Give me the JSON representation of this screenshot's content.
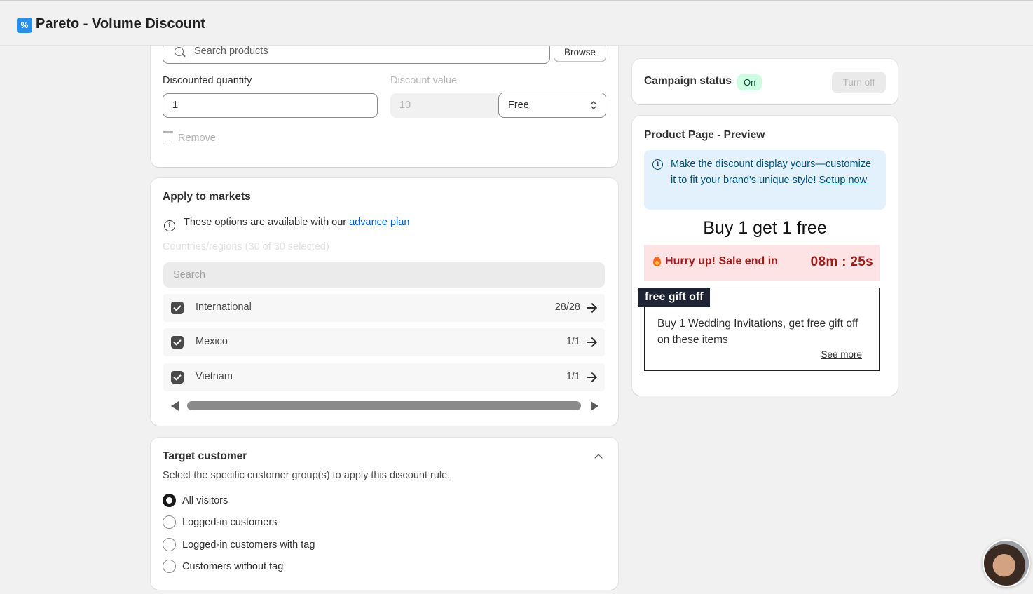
{
  "app": {
    "logo_glyph": "%",
    "title": "Pareto - Volume Discount"
  },
  "product_rule": {
    "search_placeholder": "Search products",
    "browse_label": "Browse",
    "discounted_quantity_label": "Discounted quantity",
    "discounted_quantity_value": "1",
    "discount_value_label": "Discount value",
    "discount_value": "10",
    "discount_type_selected": "Free",
    "remove_label": "Remove"
  },
  "markets": {
    "title": "Apply to markets",
    "info_prefix": "These options are available with our",
    "info_link": "advance plan",
    "countries_label": "Countries/regions (30 of 30 selected)",
    "search_placeholder": "Search",
    "items": [
      {
        "name": "International",
        "count": "28/28",
        "checked": true
      },
      {
        "name": "Mexico",
        "count": "1/1",
        "checked": true
      },
      {
        "name": "Vietnam",
        "count": "1/1",
        "checked": true
      }
    ]
  },
  "target_customer": {
    "title": "Target customer",
    "description": "Select the specific customer group(s) to apply this discount rule.",
    "options": [
      {
        "label": "All visitors",
        "selected": true
      },
      {
        "label": "Logged-in customers",
        "selected": false
      },
      {
        "label": "Logged-in customers with tag",
        "selected": false
      },
      {
        "label": "Customers without tag",
        "selected": false
      }
    ]
  },
  "campaign": {
    "status_label": "Campaign status",
    "status_badge": "On",
    "turn_off_label": "Turn off"
  },
  "preview": {
    "title": "Product Page - Preview",
    "banner_text": "Make the discount display yours—customize it to fit your brand's unique style!",
    "banner_link": "Setup now",
    "offer_title": "Buy 1 get 1 free",
    "hurry_text": "Hurry up! Sale end in",
    "timer": "08m : 25s",
    "gift_tag": "free gift off",
    "gift_text": "Buy 1 Wedding Invitations, get free gift off on these items",
    "see_more": "See more"
  },
  "colors": {
    "accent_link": "#005bd3",
    "badge_on_bg": "#cdfee1",
    "timer_bg": "#fde3e3",
    "timer_text": "#9e1c1c",
    "banner_bg": "#e3f1fd"
  }
}
